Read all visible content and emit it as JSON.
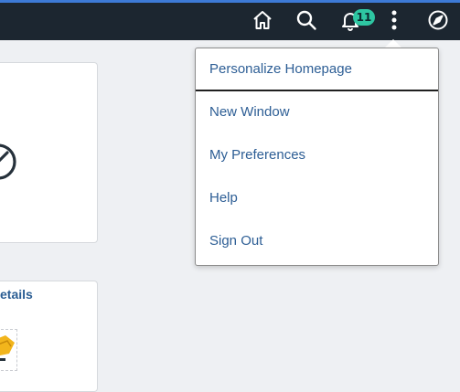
{
  "colors": {
    "topbar_bg": "#1c2630",
    "accent": "#3d7ad6",
    "icon": "#ffffff",
    "badge_bg": "#2ec6a2",
    "link": "#2d5e95",
    "tile_title": "#2a5d93"
  },
  "header": {
    "icons": [
      "home-icon",
      "search-icon",
      "bell-icon",
      "more-vertical-icon",
      "compass-icon"
    ],
    "notification_count": "11"
  },
  "tiles": {
    "second_title_visible": "etails"
  },
  "menu": {
    "items": [
      {
        "label": "Personalize Homepage"
      },
      {
        "label": "New Window"
      },
      {
        "label": "My Preferences"
      },
      {
        "label": "Help"
      },
      {
        "label": "Sign Out"
      }
    ]
  }
}
